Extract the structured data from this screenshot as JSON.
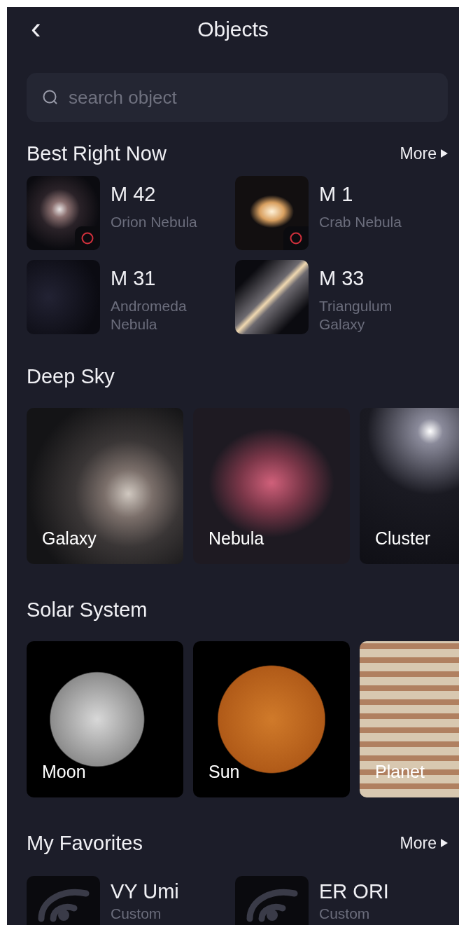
{
  "header": {
    "back_icon": "‹",
    "title": "Objects"
  },
  "search": {
    "placeholder": "search object"
  },
  "best_right_now": {
    "title": "Best Right Now",
    "more": "More",
    "items": [
      {
        "name": "M 42",
        "subtitle": "Orion Nebula",
        "marked": true
      },
      {
        "name": "M 1",
        "subtitle": "Crab Nebula",
        "marked": true
      },
      {
        "name": "M 31",
        "subtitle": "Andromeda Nebula",
        "marked": false
      },
      {
        "name": "M 33",
        "subtitle": "Triangulum Galaxy",
        "marked": false
      }
    ]
  },
  "deep_sky": {
    "title": "Deep Sky",
    "cards": [
      {
        "label": "Galaxy"
      },
      {
        "label": "Nebula"
      },
      {
        "label": "Cluster"
      }
    ]
  },
  "solar_system": {
    "title": "Solar System",
    "cards": [
      {
        "label": "Moon"
      },
      {
        "label": "Sun"
      },
      {
        "label": "Planet"
      }
    ]
  },
  "my_favorites": {
    "title": "My Favorites",
    "more": "More",
    "items": [
      {
        "name": "VY Umi",
        "subtitle": "Custom"
      },
      {
        "name": "ER ORI",
        "subtitle": "Custom"
      }
    ]
  }
}
